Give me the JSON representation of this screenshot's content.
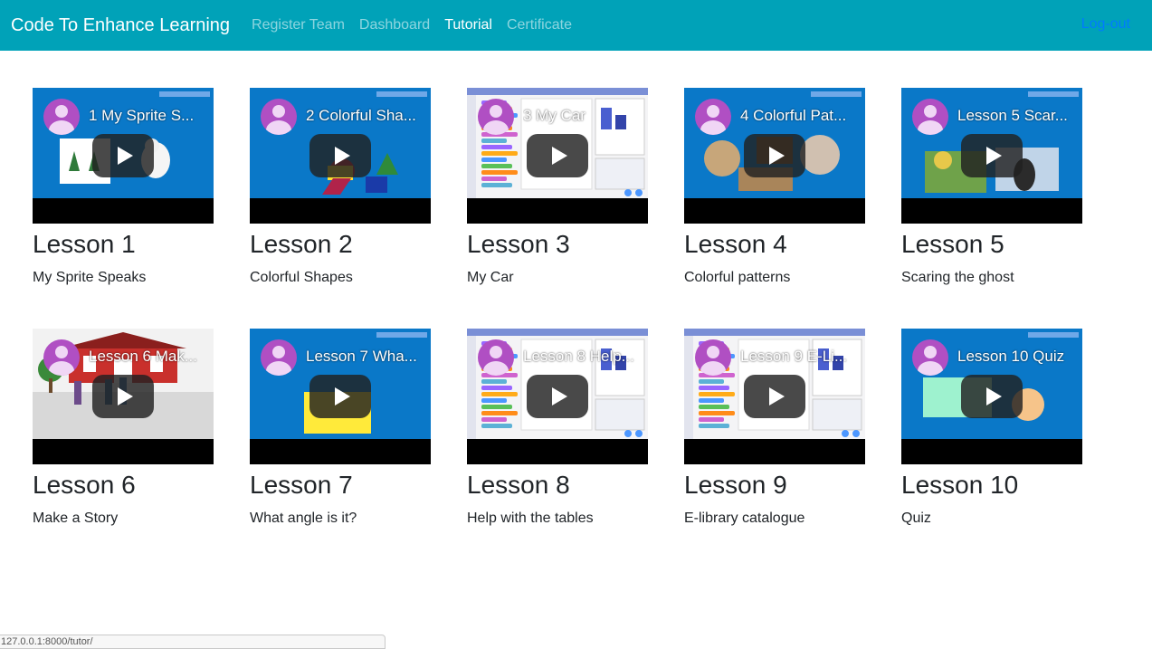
{
  "navbar": {
    "brand": "Code To Enhance Learning",
    "links": [
      {
        "label": "Register Team",
        "active": false
      },
      {
        "label": "Dashboard",
        "active": false
      },
      {
        "label": "Tutorial",
        "active": true
      },
      {
        "label": "Certificate",
        "active": false
      }
    ],
    "logout": "Log-out"
  },
  "lessons": [
    {
      "video_title": "1 My Sprite S...",
      "title": "Lesson 1",
      "subtitle": "My Sprite Speaks",
      "thumb": "blue-winter"
    },
    {
      "video_title": "2 Colorful Sha...",
      "title": "Lesson 2",
      "subtitle": "Colorful Shapes",
      "thumb": "blue-shapes"
    },
    {
      "video_title": "3 My Car",
      "title": "Lesson 3",
      "subtitle": "My Car",
      "thumb": "editor"
    },
    {
      "video_title": "4 Colorful Pat...",
      "title": "Lesson 4",
      "subtitle": "Colorful patterns",
      "thumb": "blue-patterns"
    },
    {
      "video_title": "Lesson 5 Scar...",
      "title": "Lesson 5",
      "subtitle": "Scaring the ghost",
      "thumb": "blue-photos"
    },
    {
      "video_title": "Lesson 6 Mak...",
      "title": "Lesson 6",
      "subtitle": "Make a Story",
      "thumb": "house"
    },
    {
      "video_title": "Lesson 7 Wha...",
      "title": "Lesson 7",
      "subtitle": "What angle is it?",
      "thumb": "blue-yellow"
    },
    {
      "video_title": "Lesson 8 Help...",
      "title": "Lesson 8",
      "subtitle": "Help with the tables",
      "thumb": "editor"
    },
    {
      "video_title": "Lesson 9 E-Li...",
      "title": "Lesson 9",
      "subtitle": "E-library catalogue",
      "thumb": "editor"
    },
    {
      "video_title": "Lesson 10 Quiz",
      "title": "Lesson 10",
      "subtitle": "Quiz",
      "thumb": "blue-quiz"
    }
  ],
  "status_url": "127.0.0.1:8000/tutor/",
  "colors": {
    "navbar": "#00a2b8",
    "logout": "#007bff",
    "slide_blue": "#0a78c8",
    "avatar": "#b04fc3"
  },
  "icons": {
    "avatar": "user-avatar-icon",
    "play": "play-icon"
  }
}
